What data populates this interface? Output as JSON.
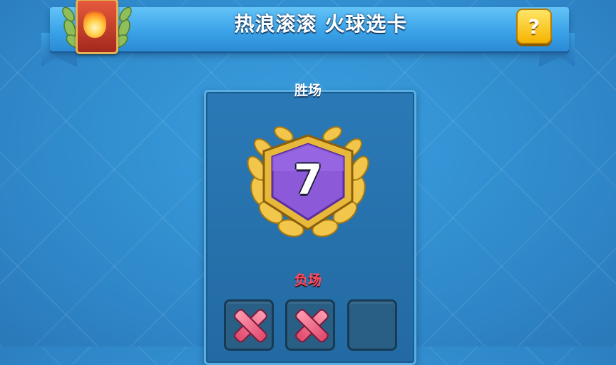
{
  "header": {
    "title": "热浪滚滚 火球选卡",
    "help_label": "?",
    "card_icon": "fireball-card-icon"
  },
  "panel": {
    "wins_label": "胜场",
    "wins_count": "7",
    "losses_label": "负场",
    "losses": [
      {
        "state": "lost",
        "icon": "cross-icon"
      },
      {
        "state": "lost",
        "icon": "cross-icon"
      },
      {
        "state": "empty",
        "icon": ""
      }
    ]
  },
  "colors": {
    "banner": "#3ba3e8",
    "badge_fill": "#8c5ad9",
    "laurel_gold": "#f2c64a",
    "loss_text": "#ff4a5a",
    "help_button": "#f5b400"
  }
}
